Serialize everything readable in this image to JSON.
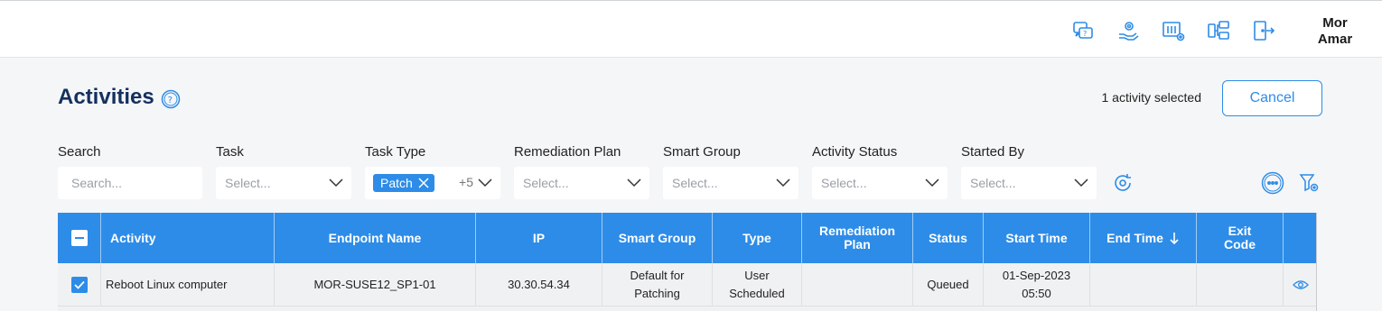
{
  "header": {
    "icons": [
      "help-chat-icon",
      "support-hand-gear-icon",
      "settings-panel-icon",
      "endpoint-network-icon",
      "logout-door-icon"
    ],
    "user_name_line1": "Mor",
    "user_name_line2": "Amar"
  },
  "page": {
    "title": "Activities",
    "selected_text": "1 activity selected",
    "cancel_label": "Cancel"
  },
  "filters": {
    "search": {
      "label": "Search",
      "placeholder": "Search..."
    },
    "task": {
      "label": "Task",
      "value": "Select..."
    },
    "task_type": {
      "label": "Task Type",
      "chip": "Patch",
      "more": "+5"
    },
    "remediation_plan": {
      "label": "Remediation Plan",
      "value": "Select..."
    },
    "smart_group": {
      "label": "Smart Group",
      "value": "Select..."
    },
    "activity_status": {
      "label": "Activity Status",
      "value": "Select..."
    },
    "started_by": {
      "label": "Started By",
      "value": "Select..."
    }
  },
  "table": {
    "columns": [
      "Activity",
      "Endpoint Name",
      "IP",
      "Smart Group",
      "Type",
      "Remediation Plan",
      "Status",
      "Start Time",
      "End Time",
      "Exit Code"
    ],
    "rows": [
      {
        "activity": "Reboot Linux computer",
        "endpoint": "MOR-SUSE12_SP1-01",
        "ip": "30.30.54.34",
        "smart_group_l1": "Default for",
        "smart_group_l2": "Patching",
        "type_l1": "User",
        "type_l2": "Scheduled",
        "remediation_plan": "",
        "status": "Queued",
        "start_l1": "01-Sep-2023",
        "start_l2": "05:50",
        "end": "",
        "exit_code": ""
      }
    ]
  },
  "colors": {
    "accent": "#2d8ce8",
    "title": "#14305e"
  }
}
